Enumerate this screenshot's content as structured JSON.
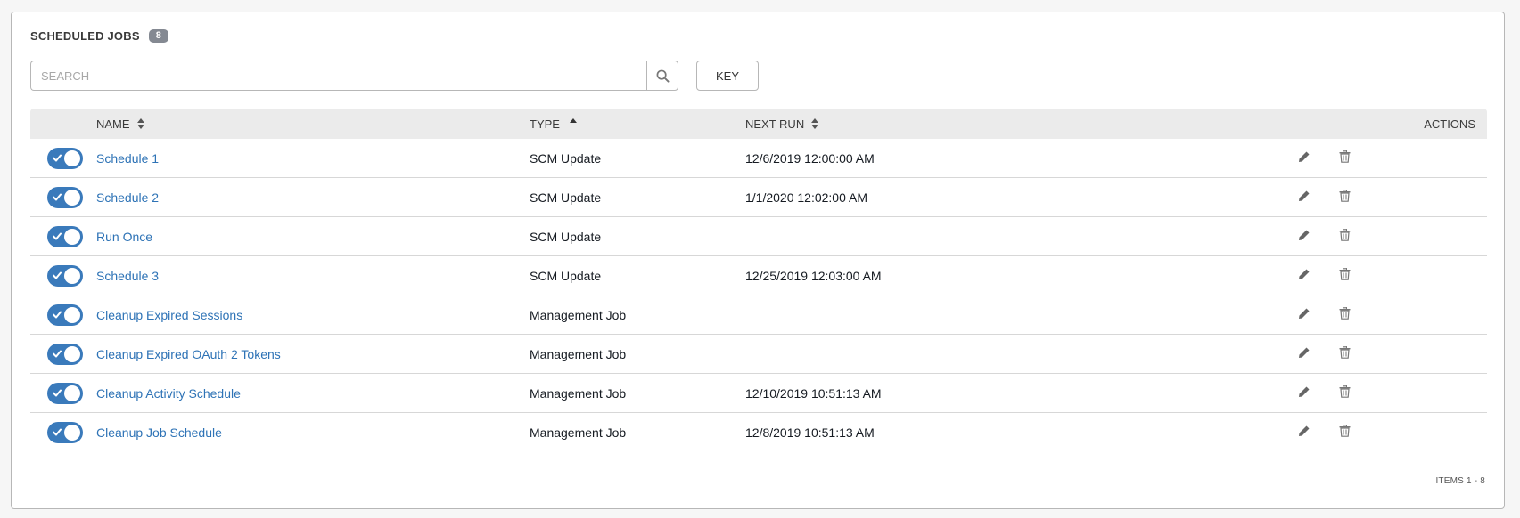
{
  "panel": {
    "title": "SCHEDULED JOBS",
    "count": "8"
  },
  "search": {
    "placeholder": "SEARCH",
    "value": "",
    "icon": "search-icon"
  },
  "key_button": {
    "label": "KEY"
  },
  "table": {
    "columns": {
      "name": "NAME",
      "type": "TYPE",
      "next_run": "NEXT RUN",
      "actions": "ACTIONS"
    },
    "rows": [
      {
        "name": "Schedule 1",
        "type": "SCM Update",
        "next_run": "12/6/2019 12:00:00 AM",
        "enabled": true
      },
      {
        "name": "Schedule 2",
        "type": "SCM Update",
        "next_run": "1/1/2020 12:02:00 AM",
        "enabled": true
      },
      {
        "name": "Run Once",
        "type": "SCM Update",
        "next_run": "",
        "enabled": true
      },
      {
        "name": "Schedule 3",
        "type": "SCM Update",
        "next_run": "12/25/2019 12:03:00 AM",
        "enabled": true
      },
      {
        "name": "Cleanup Expired Sessions",
        "type": "Management Job",
        "next_run": "",
        "enabled": true
      },
      {
        "name": "Cleanup Expired OAuth 2 Tokens",
        "type": "Management Job",
        "next_run": "",
        "enabled": true
      },
      {
        "name": "Cleanup Activity Schedule",
        "type": "Management Job",
        "next_run": "12/10/2019 10:51:13 AM",
        "enabled": true
      },
      {
        "name": "Cleanup Job Schedule",
        "type": "Management Job",
        "next_run": "12/8/2019 10:51:13 AM",
        "enabled": true
      }
    ]
  },
  "footer": {
    "items_label": "ITEMS  1 - 8"
  },
  "colors": {
    "toggle_on": "#3a7abb",
    "link": "#2e73b6",
    "header_bg": "#ebebeb"
  }
}
